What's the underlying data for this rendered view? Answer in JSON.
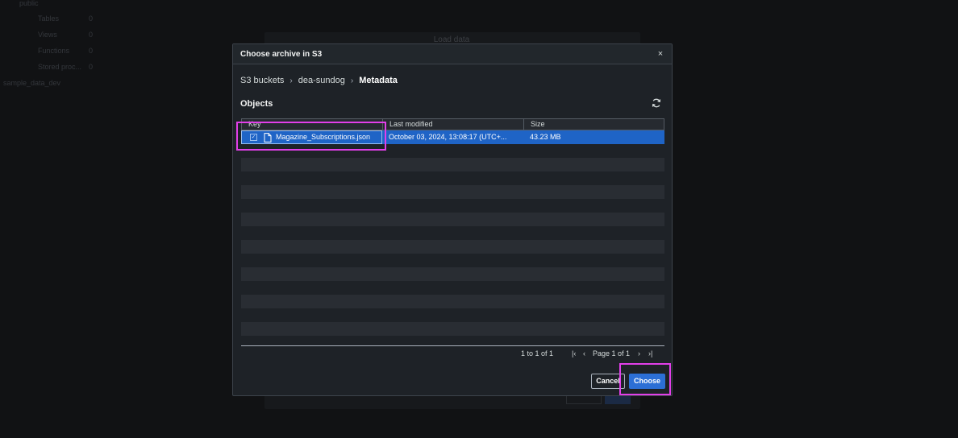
{
  "background": {
    "schema_name": "public",
    "tree_items": [
      {
        "label": "Tables",
        "count": "0"
      },
      {
        "label": "Views",
        "count": "0"
      },
      {
        "label": "Functions",
        "count": "0"
      },
      {
        "label": "Stored proc...",
        "count": "0"
      }
    ],
    "database_name": "sample_data_dev",
    "panel_title": "Load data"
  },
  "modal": {
    "title": "Choose archive in S3",
    "close_label": "×",
    "breadcrumb": [
      "S3 buckets",
      "dea-sundog",
      "Metadata"
    ],
    "objects_title": "Objects",
    "columns": {
      "key": "Key",
      "last_modified": "Last modified",
      "size": "Size"
    },
    "rows": [
      {
        "key": "Magazine_Subscriptions.json",
        "last_modified": "October 03, 2024, 13:08:17 (UTC+...",
        "size": "43.23 MB",
        "selected": true
      }
    ],
    "pagination": {
      "count_label": "1 to 1 of 1",
      "first": "|‹",
      "prev": "‹",
      "page_label": "Page 1 of 1",
      "next": "›",
      "last": "›|"
    },
    "cancel_label": "Cancel",
    "choose_label": "Choose"
  },
  "colors": {
    "accent": "#2c6fd6",
    "highlight": "#e23fe9",
    "selected_row": "#1f64c6"
  }
}
